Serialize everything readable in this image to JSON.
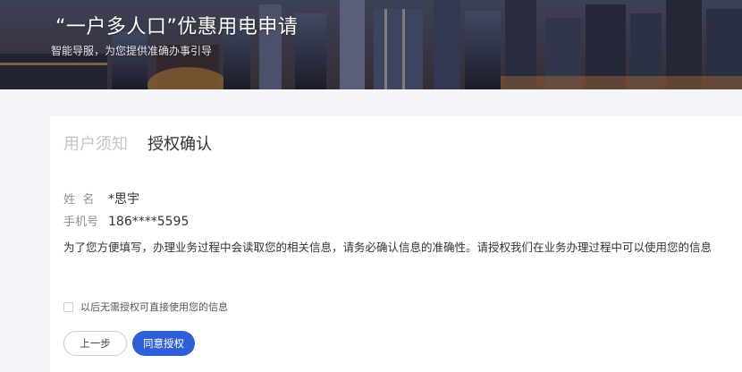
{
  "banner": {
    "title": "“一户多人口”优惠用电申请",
    "subtitle": "智能导服，为您提供准确办事引导"
  },
  "tabs": [
    {
      "label": "用户须知",
      "active": false
    },
    {
      "label": "授权确认",
      "active": true
    }
  ],
  "form": {
    "name_label": "姓  名",
    "name_value": "*思宇",
    "phone_label": "手机号",
    "phone_value": "186****5595"
  },
  "notice": "为了您方便填写，办理业务过程中会读取您的相关信息，请务必确认信息的准确性。请授权我们在业务办理过程中可以使用您的信息",
  "checkbox": {
    "label": "以后无需授权可直接使用您的信息",
    "checked": false
  },
  "buttons": {
    "prev": "上一步",
    "agree": "同意授权"
  },
  "colors": {
    "primary": "#2f5fd6",
    "page_bg": "#f3f5f8",
    "inactive_tab": "#c2c5cc"
  }
}
